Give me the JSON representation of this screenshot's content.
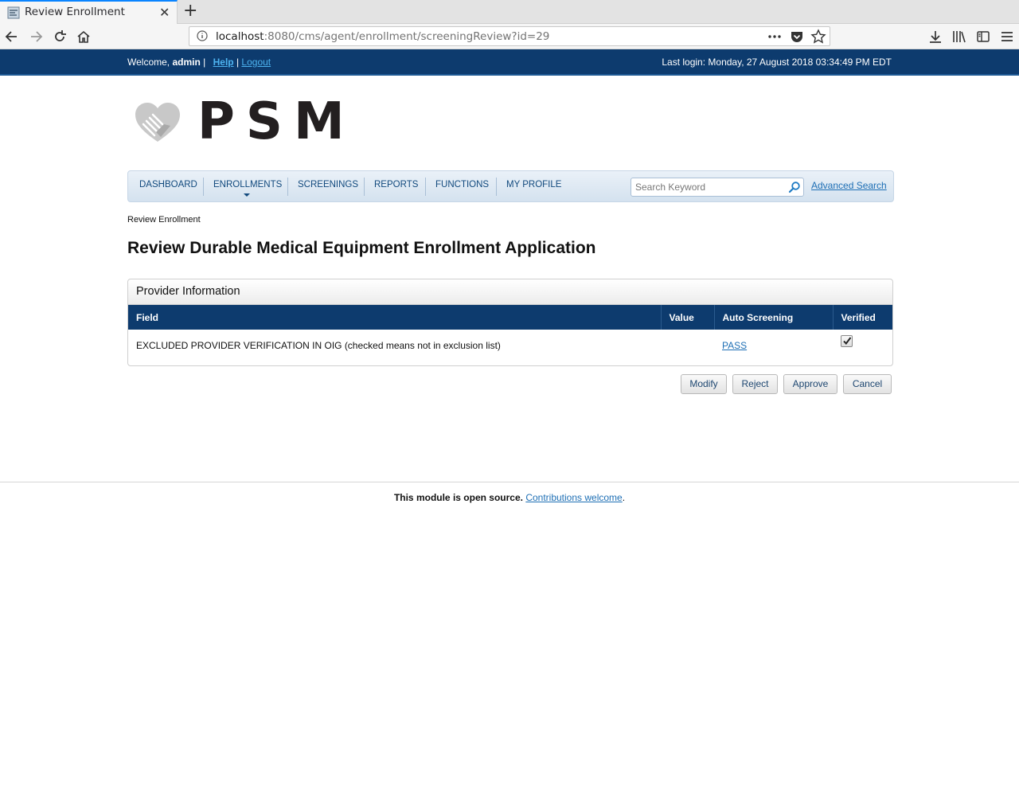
{
  "browser": {
    "tab_title": "Review Enrollment",
    "url_host": "localhost",
    "url_rest": ":8080/cms/agent/enrollment/screeningReview?id=29"
  },
  "header": {
    "welcome_prefix": "Welcome, ",
    "username": "admin",
    "sep1": " | ",
    "help": "Help",
    "sep2": " | ",
    "logout": "Logout",
    "last_login": "Last login: Monday, 27 August 2018 03:34:49 PM EDT"
  },
  "logo": {
    "text": "PSM"
  },
  "nav": {
    "items": [
      "DASHBOARD",
      "ENROLLMENTS",
      "SCREENINGS",
      "REPORTS",
      "FUNCTIONS",
      "MY PROFILE"
    ],
    "search_placeholder": "Search Keyword",
    "advanced_search": "Advanced Search"
  },
  "breadcrumb": "Review Enrollment",
  "page_title": "Review Durable Medical Equipment Enrollment Application",
  "panel": {
    "title": "Provider Information",
    "columns": [
      "Field",
      "Value",
      "Auto Screening",
      "Verified"
    ],
    "rows": [
      {
        "field": "EXCLUDED PROVIDER VERIFICATION IN OIG (checked means not in exclusion list)",
        "value": "",
        "auto_screening": "PASS",
        "verified": true
      }
    ]
  },
  "buttons": {
    "modify": "Modify",
    "reject": "Reject",
    "approve": "Approve",
    "cancel": "Cancel"
  },
  "footer": {
    "bold": "This module is open source.",
    "link": "Contributions welcome",
    "end": "."
  },
  "colors": {
    "topbar": "#0d3b6e",
    "link": "#1e6fb5",
    "nav_text": "#124a7e"
  }
}
